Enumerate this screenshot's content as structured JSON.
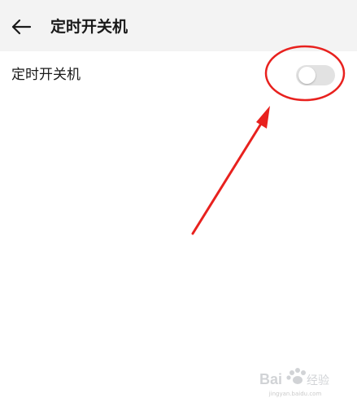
{
  "header": {
    "title": "定时开关机",
    "back_icon": "back-arrow-icon"
  },
  "setting": {
    "label": "定时开关机",
    "toggle_on": false
  },
  "annotation": {
    "circle_color": "#e8211e",
    "arrow_color": "#e8211e"
  },
  "watermark": {
    "logo_text": "Bai经验",
    "url": "jingyan.baidu.com"
  }
}
